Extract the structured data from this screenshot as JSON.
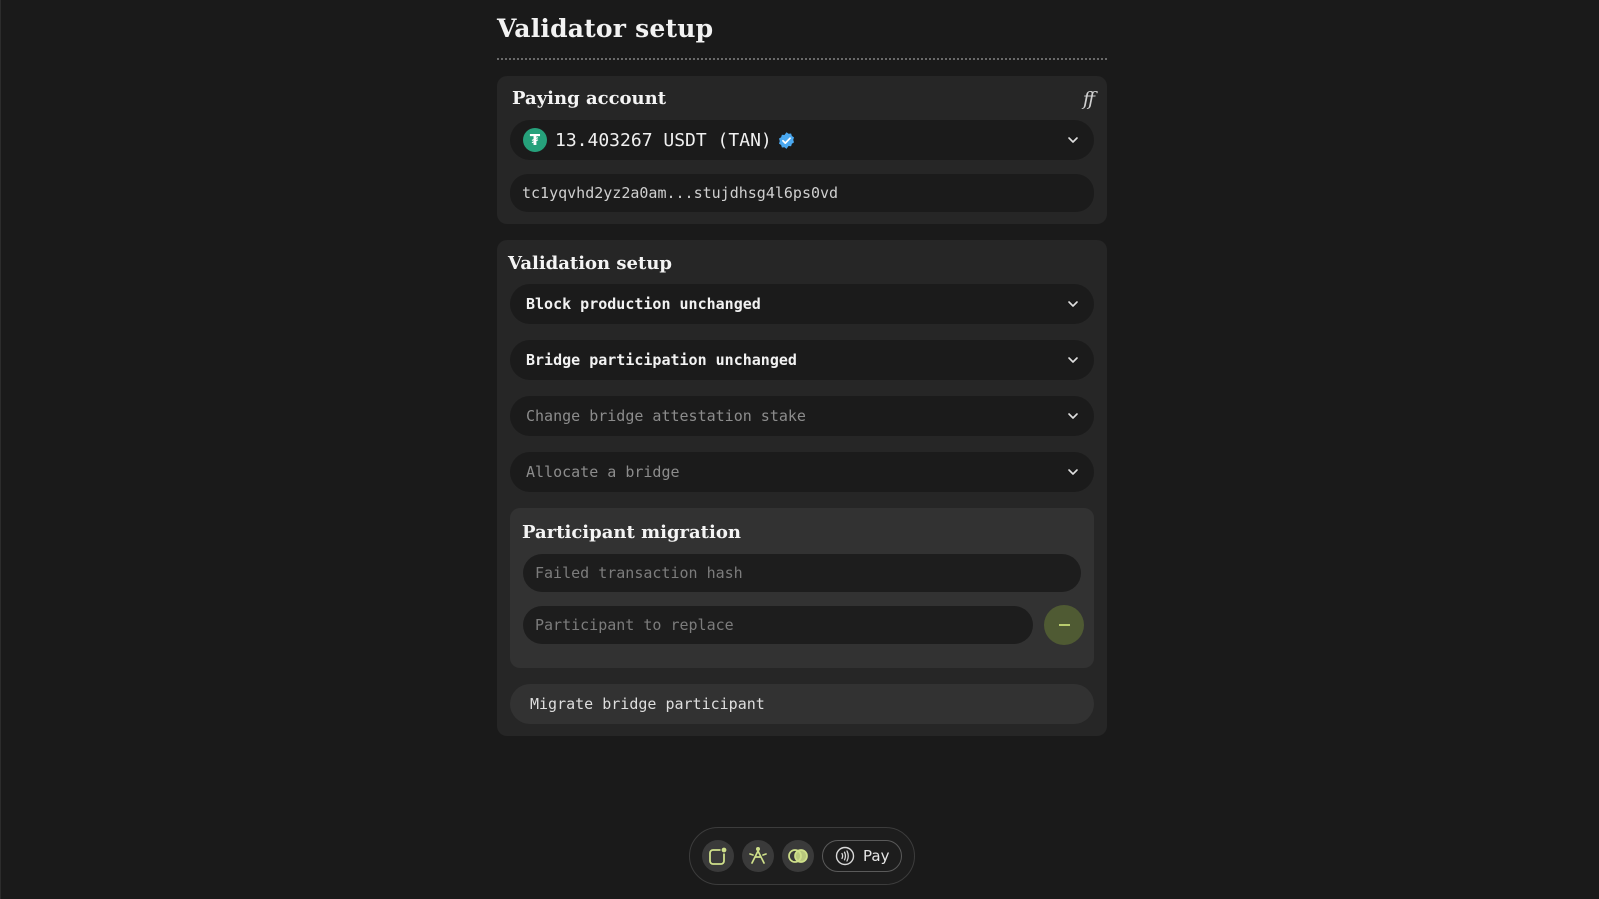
{
  "page": {
    "title": "Validator setup"
  },
  "paying_account": {
    "heading": "Paying account",
    "corner_icon_text": "ff",
    "asset": {
      "amount_label": "13.403267 USDT (TAN)",
      "token_icon": "tether-icon",
      "token_icon_glyph": "₮",
      "verified_icon": "verified-badge-icon"
    },
    "address": "tc1yqvhd2yz2a0am...stujdhsg4l6ps0vd"
  },
  "validation_setup": {
    "heading": "Validation setup",
    "dropdowns": [
      {
        "label": "Block production unchanged"
      },
      {
        "label": "Bridge participation unchanged"
      },
      {
        "label": "Change bridge attestation stake"
      },
      {
        "label": "Allocate a bridge"
      }
    ],
    "participant_migration": {
      "heading": "Participant migration",
      "hash_placeholder": "Failed transaction hash",
      "participant_placeholder": "Participant to replace",
      "remove_icon": "minus-icon"
    },
    "migrate_button": "Migrate bridge participant"
  },
  "toolbar": {
    "items": [
      {
        "icon": "notification-square-icon"
      },
      {
        "icon": "network-icon"
      },
      {
        "icon": "overlap-circles-icon"
      }
    ],
    "pay_label": "Pay",
    "pay_icon": "contactless-icon"
  },
  "colors": {
    "background": "#1a1a1a",
    "card": "#262626",
    "field": "#1b1b1b",
    "accent_green": "#b9cc6e",
    "tether_green": "#26a17b",
    "verified_blue": "#4aa8f0"
  }
}
